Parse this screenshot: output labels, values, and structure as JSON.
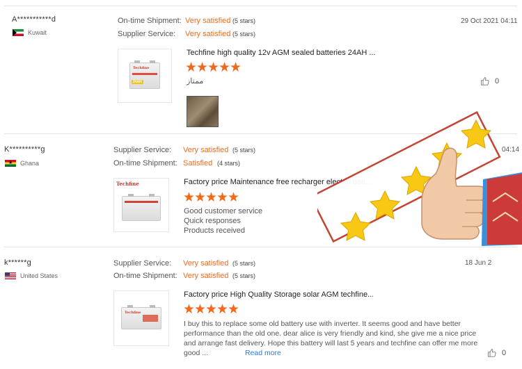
{
  "reviews": [
    {
      "buyer": "A***********d",
      "country": "Kuwait",
      "ratings": [
        {
          "label": "On-time Shipment:",
          "value": "Very satisfied",
          "stars_text": "(5 stars)"
        },
        {
          "label": "Supplier Service:",
          "value": "Very satisfied",
          "stars_text": "(5 stars)"
        }
      ],
      "date": "29 Oct 2021 04:11",
      "product_title": "Techfine high quality 12v AGM sealed batteries 24AH ...",
      "product_badge": "24AH",
      "brand": "Techfine",
      "stars": 5,
      "comment": [
        "ممتاز"
      ],
      "likes": "0"
    },
    {
      "buyer": "K**********g",
      "country": "Ghana",
      "ratings": [
        {
          "label": "Supplier Service:",
          "value": "Very satisfied",
          "stars_text": "(5 stars)"
        },
        {
          "label": "On-time Shipment:",
          "value": "Satisfied",
          "stars_text": "(4 stars)"
        }
      ],
      "date": "04:14",
      "product_title": "Factory price Maintenance free recharger electric batt...",
      "brand": "Techfine",
      "stars": 5,
      "comment": [
        "Good customer service",
        "Quick responses",
        "Products received"
      ],
      "likes": ""
    },
    {
      "buyer": "k******g",
      "country": "United States",
      "ratings": [
        {
          "label": "Supplier Service:",
          "value": "Very satisfied",
          "stars_text": "(5 stars)"
        },
        {
          "label": "On-time Shipment:",
          "value": "Very satisfied",
          "stars_text": "(5 stars)"
        }
      ],
      "date": "18 Jun 2",
      "product_title": "Factory price High Quality Storage solar AGM techfine...",
      "brand": "Techfine",
      "stars": 5,
      "comment_long": "I buy this to replace some old battery use with inverter. It seems good and have better performance than the old one. dear alice is very friendly and kind, she give me a nice price and arrange fast delivery. Hope this battery will last 5 years and techfine can offer me more good ...",
      "read_more": "Read more",
      "likes": "0"
    }
  ],
  "overlay": {
    "description_icon": "thumbs-up-five-stars-icon",
    "star_color": "#f7c915",
    "frame_color": "#c0392b"
  },
  "colors": {
    "accent": "#f06a1d",
    "link": "#2b7ad8"
  }
}
